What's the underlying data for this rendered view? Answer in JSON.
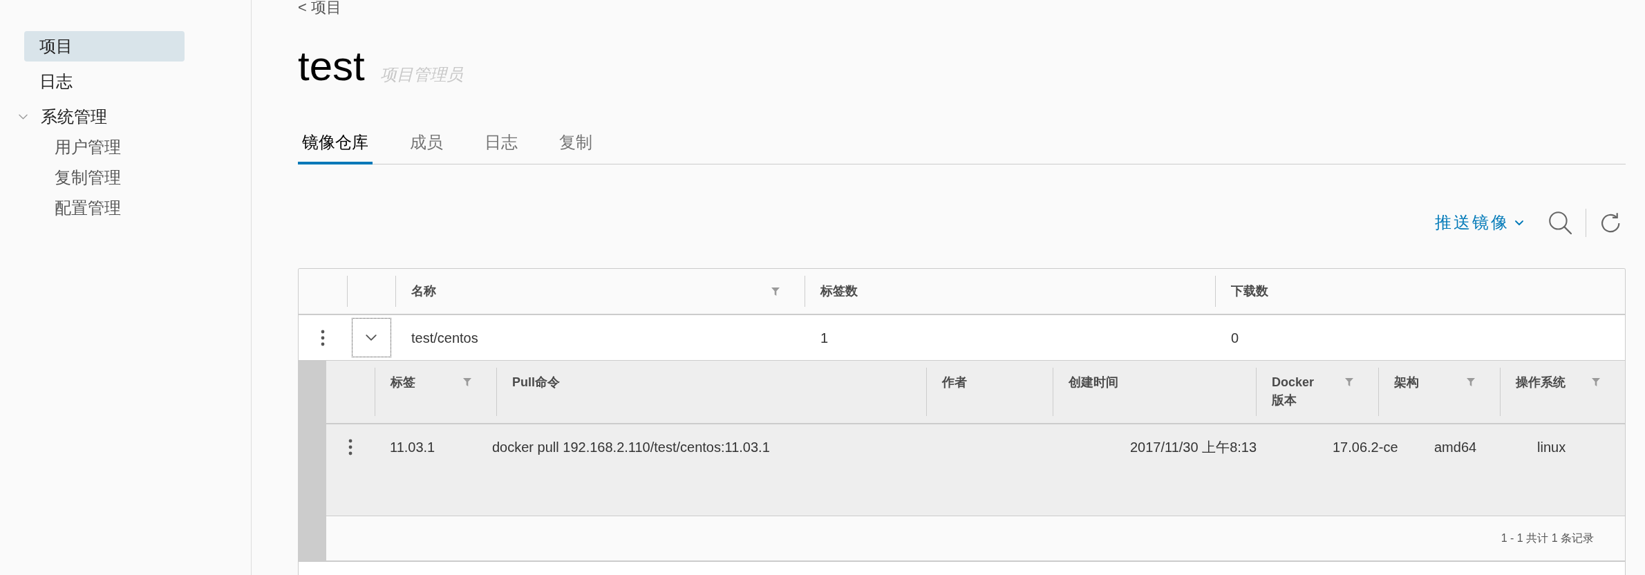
{
  "sidebar": {
    "items": [
      {
        "label": "项目",
        "selected": true
      },
      {
        "label": "日志",
        "selected": false
      },
      {
        "label": "系统管理",
        "selected": false,
        "expanded": true,
        "children": [
          {
            "label": "用户管理",
            "selected": false
          },
          {
            "label": "复制管理",
            "selected": false
          },
          {
            "label": "配置管理",
            "selected": false
          }
        ]
      }
    ]
  },
  "breadcrumb": {
    "label": "< 项目"
  },
  "header": {
    "title": "test",
    "role": "项目管理员"
  },
  "tabs": [
    {
      "label": "镜像仓库",
      "selected": true
    },
    {
      "label": "成员",
      "selected": false
    },
    {
      "label": "日志",
      "selected": false
    },
    {
      "label": "复制",
      "selected": false
    }
  ],
  "toolbar": {
    "push_button": "推送镜像"
  },
  "repositories": {
    "columns": [
      {
        "label": "名称",
        "filterable": true
      },
      {
        "label": "标签数",
        "filterable": false
      },
      {
        "label": "下载数",
        "filterable": false
      }
    ],
    "rows": [
      {
        "cells": [
          "test/centos",
          "1",
          "0"
        ],
        "expanded": true,
        "tags": {
          "columns": [
            {
              "label": "标签",
              "filterable": true
            },
            {
              "label": "Pull命令",
              "filterable": false
            },
            {
              "label": "作者",
              "filterable": false
            },
            {
              "label": "创建时间",
              "filterable": false
            },
            {
              "label": "Docker 版本",
              "filterable": true
            },
            {
              "label": "架构",
              "filterable": true
            },
            {
              "label": "操作系统",
              "filterable": true
            }
          ],
          "rows": [
            {
              "tag": "11.03.1",
              "pull_command": "docker pull 192.168.2.110/test/centos:11.03.1",
              "created": "2017/11/30 上午8:13",
              "docker_version": "17.06.2-ce",
              "architecture": "amd64",
              "os": "linux"
            }
          ],
          "footer": "1 - 1 共计 1 条记录"
        }
      }
    ]
  }
}
